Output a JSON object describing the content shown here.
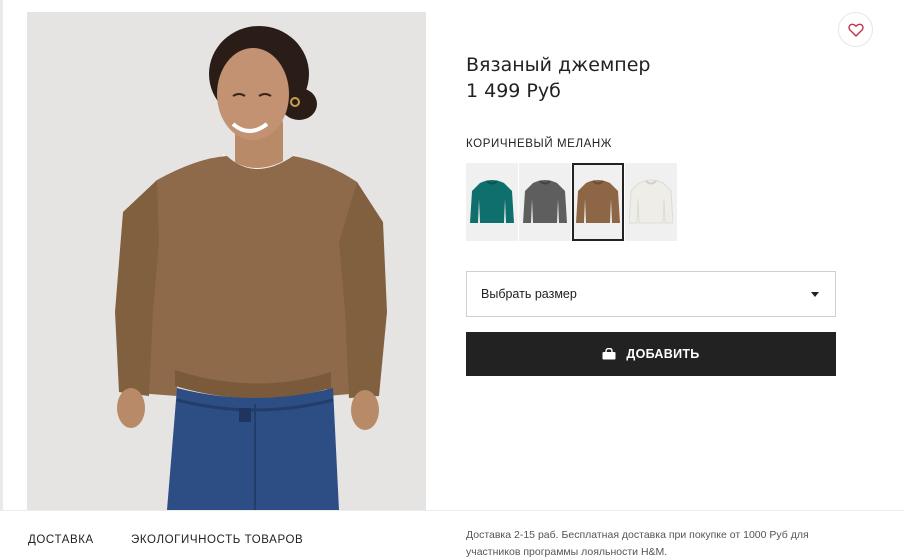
{
  "product": {
    "title": "Вязаный джемпер",
    "price": "1 499 Руб"
  },
  "color": {
    "selected_label": "КОРИЧНЕВЫЙ МЕЛАНЖ",
    "swatches": [
      {
        "name": "teal",
        "color": "#0e6f6c"
      },
      {
        "name": "grey",
        "color": "#5e5e5e"
      },
      {
        "name": "brown",
        "color": "#8d6646"
      },
      {
        "name": "white",
        "color": "#eeede8"
      }
    ],
    "selected_index": 2
  },
  "size_select": {
    "placeholder": "Выбрать размер"
  },
  "add_button": {
    "label": "ДОБАВИТЬ"
  },
  "bottom_tabs": {
    "delivery": "ДОСТАВКА",
    "eco": "ЭКОЛОГИЧНОСТЬ ТОВАРОВ"
  },
  "delivery_note": "Доставка 2-15 раб. Бесплатная доставка при покупке от 1000 Руб для участников программы лояльности H&M.",
  "colors": {
    "accent_dark": "#222222",
    "favorite_heart": "#c0314a"
  },
  "icons": {
    "favorite": "heart-icon",
    "bag": "shopping-bag-icon",
    "dropdown": "caret-down-icon"
  }
}
